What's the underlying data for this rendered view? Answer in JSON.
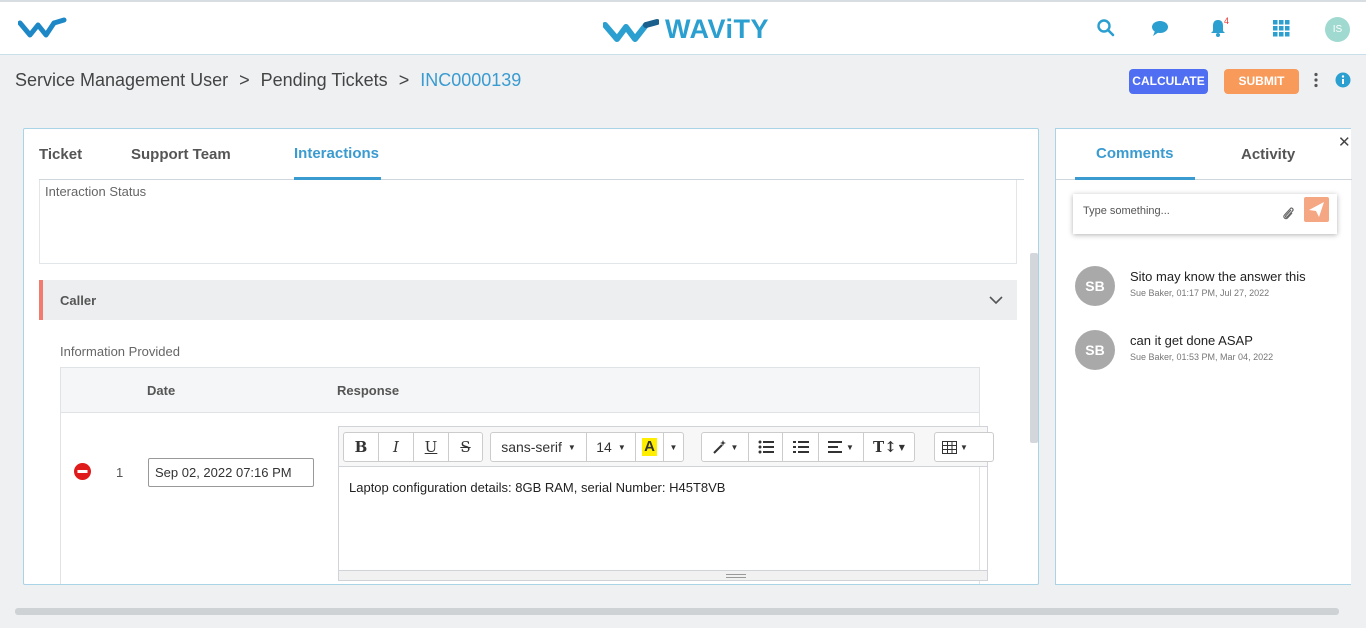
{
  "header": {
    "brand": "WAViTY",
    "notification_count": "4",
    "user_initials": "IS"
  },
  "breadcrumb": {
    "items": [
      "Service Management User",
      "Pending Tickets"
    ],
    "separator": ">",
    "current": "INC0000139"
  },
  "actions": {
    "calculate_label": "CALCULATE",
    "submit_label": "SUBMIT"
  },
  "tabs": [
    {
      "label": "Ticket"
    },
    {
      "label": "Support Team"
    },
    {
      "label": "Interactions",
      "active": true
    }
  ],
  "interaction": {
    "status_label": "Interaction Status",
    "caller_section": "Caller",
    "info_label": "Information Provided",
    "table": {
      "columns": [
        "Date",
        "Response"
      ],
      "rows": [
        {
          "index": "1",
          "date": "Sep 02, 2022 07:16 PM",
          "response": "Laptop configuration details: 8GB RAM, serial Number: H45T8VB"
        }
      ]
    },
    "editor_toolbar": {
      "bold": "B",
      "italic": "I",
      "underline": "U",
      "strike": "S",
      "font_family": "sans-serif",
      "font_size": "14",
      "color_label": "A"
    }
  },
  "side_panel": {
    "tabs": [
      {
        "label": "Comments",
        "active": true
      },
      {
        "label": "Activity"
      }
    ],
    "input_placeholder": "Type something...",
    "comments": [
      {
        "initials": "SB",
        "text": "Sito may know the answer this",
        "meta": "Sue Baker, 01:17 PM, Jul 27, 2022"
      },
      {
        "initials": "SB",
        "text": "can it get done ASAP",
        "meta": "Sue Baker, 01:53 PM, Mar 04, 2022"
      }
    ]
  },
  "colors": {
    "accent": "#3a9bd0",
    "calculate": "#4f6ef2",
    "submit": "#f79a5a",
    "caller_marker": "#f17b6f",
    "send": "#f5a783"
  }
}
